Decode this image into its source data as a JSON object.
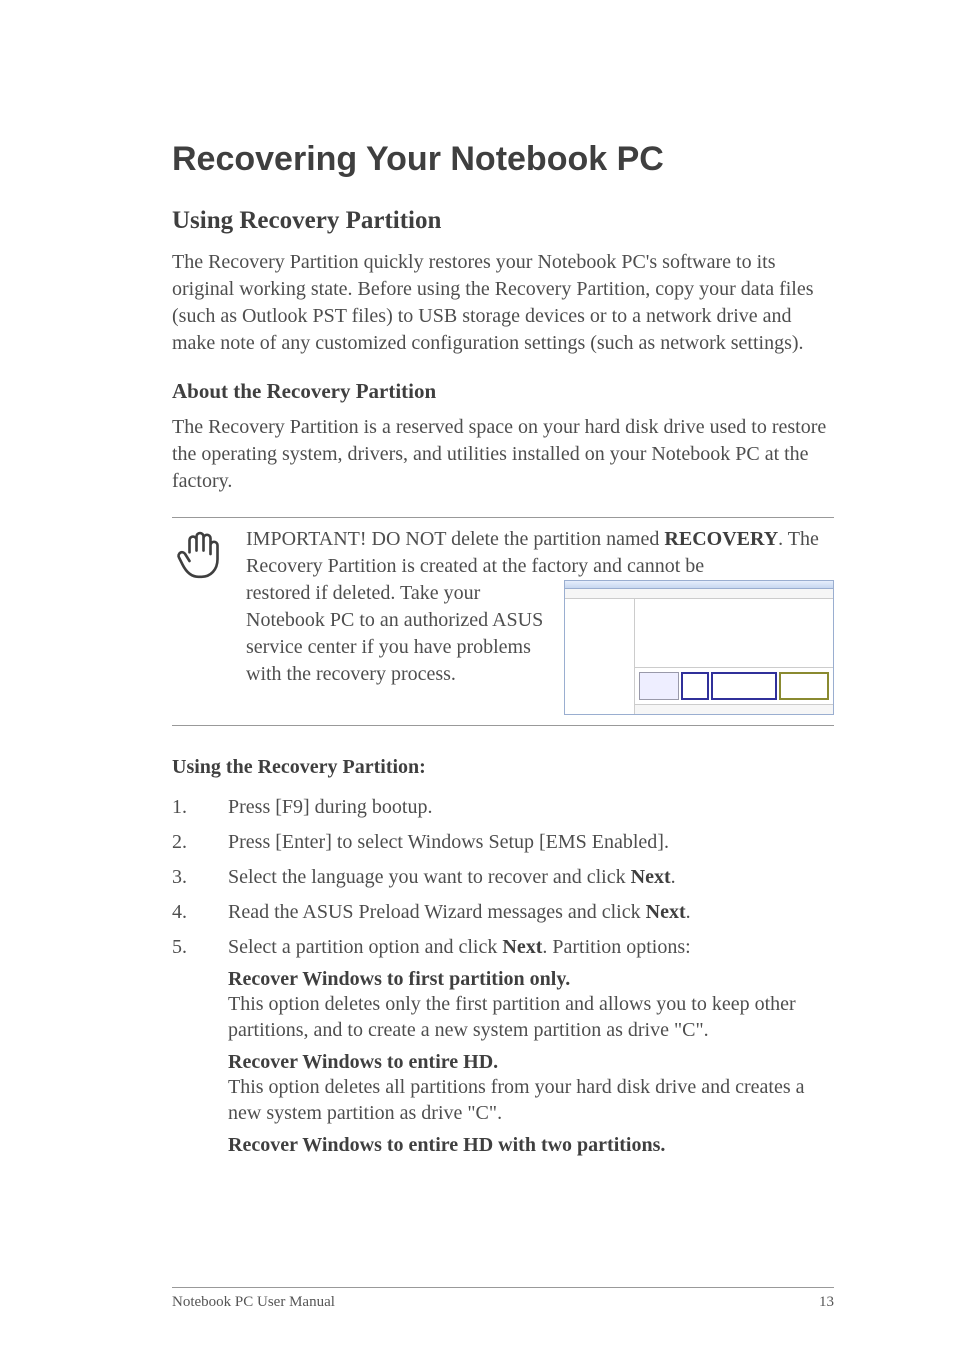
{
  "h1": "Recovering Your Notebook PC",
  "h2": "Using Recovery Partition",
  "intro": "The Recovery Partition quickly restores your Notebook PC's software to its original working state. Before using the Recovery Partition, copy your data files (such as Outlook PST files) to USB storage devices or to a network drive and make note of any customized configuration settings (such as network settings).",
  "h3": "About the Recovery Partition",
  "about": "The Recovery Partition is a reserved space on your hard disk drive used to restore the operating system, drivers, and utilities installed on your Notebook PC at the factory.",
  "important_lead": "IMPORTANT! DO NOT delete the partition named ",
  "important_bold": "RECOVERY",
  "important_tail": ". The Recovery Partition is created at the factory and cannot be restored if deleted. Take your Notebook PC to an authorized ASUS service center if you have problems with the recovery process.",
  "h4": "Using the Recovery Partition:",
  "steps": [
    "Press [F9] during bootup.",
    "Press [Enter] to select Windows Setup [EMS Enabled].",
    "Select the language you want to recover and click ",
    "Read the ASUS Preload Wizard messages and click ",
    "Select a partition option and click "
  ],
  "next": "Next",
  "step5_tail": ". Partition options:",
  "opts": [
    {
      "title": "Recover Windows to first partition only.",
      "desc": "This option deletes only the first partition and allows you to keep other partitions, and to create a new system partition as drive \"C\"."
    },
    {
      "title": "Recover Windows to entire HD.",
      "desc": "This option deletes all partitions from your hard disk drive and creates a new system partition as drive \"C\"."
    },
    {
      "title": "Recover Windows to entire HD with two partitions.",
      "desc": ""
    }
  ],
  "footer_left": "Notebook PC User Manual",
  "footer_right": "13"
}
